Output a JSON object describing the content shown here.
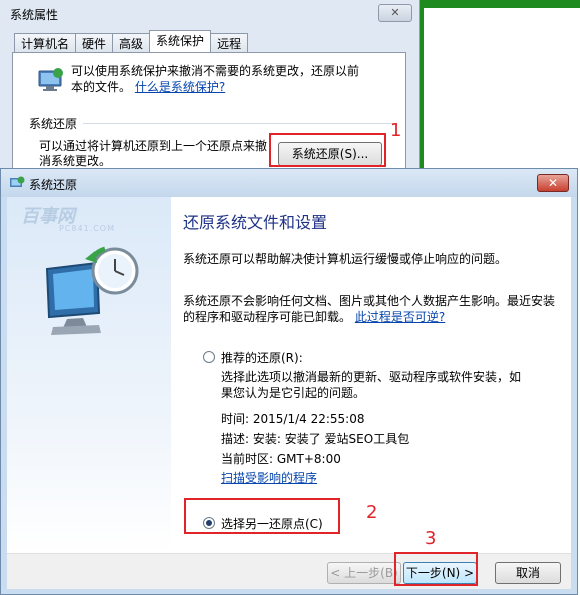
{
  "system_properties": {
    "title": "系统属性",
    "tabs": [
      "计算机名",
      "硬件",
      "高级",
      "系统保护",
      "远程"
    ],
    "active_tab": "系统保护",
    "intro_text": "可以使用系统保护来撤消不需要的系统更改，还原以前",
    "intro_text_2": "本的文件。",
    "intro_link": "什么是系统保护?",
    "group_label": "系统还原",
    "restore_desc": "可以通过将计算机还原到上一个还原点来撤消系统更改。",
    "restore_button": "系统还原(S)..."
  },
  "system_restore": {
    "title": "系统还原",
    "watermark": "百事网",
    "watermark_sub": "PC841.COM",
    "heading": "还原系统文件和设置",
    "para1": "系统还原可以帮助解决使计算机运行缓慢或停止响应的问题。",
    "para2": "系统还原不会影响任何文档、图片或其他个人数据产生影响。最近安装的程序和驱动程序可能已卸载。",
    "para2_link": "此过程是否可逆?",
    "recommended_label": "推荐的还原(R):",
    "recommended_desc": "选择此选项以撤消最新的更新、驱动程序或软件安装，如果您认为是它引起的问题。",
    "time_label": "时间:",
    "time_value": "2015/1/4 22:55:08",
    "desc_label": "描述:",
    "desc_value": "安装: 安装了 爱站SEO工具包",
    "tz_label": "当前时区:",
    "tz_value": "GMT+8:00",
    "scan_link": "扫描受影响的程序",
    "choose_label": "选择另一还原点(C)",
    "buttons": {
      "back": "< 上一步(B)",
      "next": "下一步(N) >",
      "cancel": "取消"
    }
  },
  "annotations": [
    "1",
    "2",
    "3"
  ],
  "colors": {
    "annotation_red": "#e0242a",
    "heading_blue": "#1e3287",
    "link_blue": "#0645ad",
    "green_strip": "#1f8a1f"
  }
}
